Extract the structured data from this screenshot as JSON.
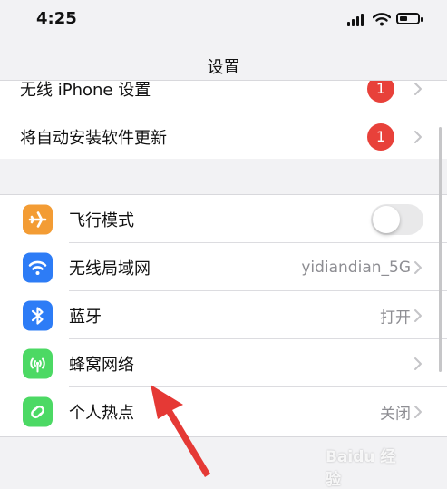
{
  "status_bar": {
    "time": "4:25"
  },
  "nav": {
    "title": "设置"
  },
  "top_group": [
    {
      "label": "无线 iPhone 设置",
      "badge": "1"
    },
    {
      "label": "将自动安装软件更新",
      "badge": "1"
    }
  ],
  "main_group": [
    {
      "label": "飞行模式",
      "icon": "airplane-icon",
      "icon_color": "#f39c34",
      "toggle_on": false
    },
    {
      "label": "无线局域网",
      "icon": "wifi-icon",
      "icon_color": "#2d7cf6",
      "value": "yidiandian_5G"
    },
    {
      "label": "蓝牙",
      "icon": "bluetooth-icon",
      "icon_color": "#2d7cf6",
      "value": "打开"
    },
    {
      "label": "蜂窝网络",
      "icon": "cellular-icon",
      "icon_color": "#4cd964",
      "value": ""
    },
    {
      "label": "个人热点",
      "icon": "hotspot-icon",
      "icon_color": "#4cd964",
      "value": "关闭"
    }
  ],
  "watermark": {
    "text": "Baidu 经验"
  },
  "colors": {
    "badge": "#e8413a",
    "arrow": "#e53935"
  }
}
